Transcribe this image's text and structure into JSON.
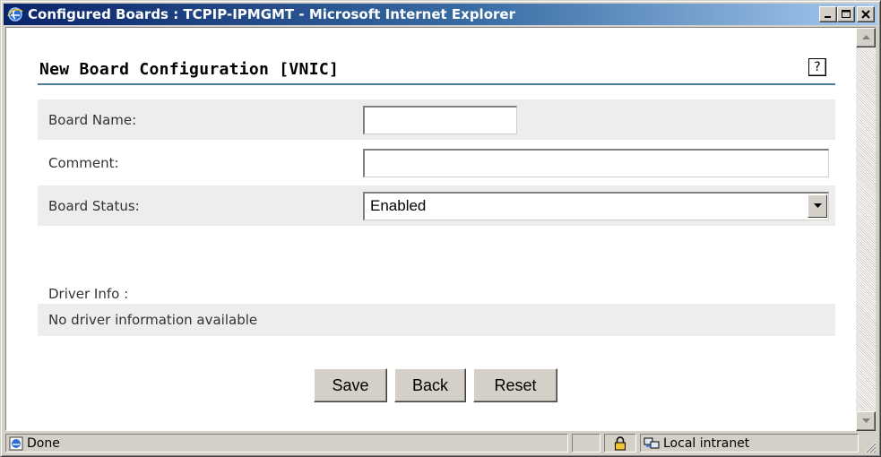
{
  "window": {
    "title": "Configured Boards : TCPIP-IPMGMT - Microsoft Internet Explorer",
    "minimize_label": "_",
    "maximize_label": "□",
    "close_label": "✕"
  },
  "page": {
    "title": "New Board Configuration [VNIC]",
    "help_label": "?"
  },
  "form": {
    "board_name": {
      "label": "Board Name:",
      "value": ""
    },
    "comment": {
      "label": "Comment:",
      "value": ""
    },
    "board_status": {
      "label": "Board Status:",
      "value": "Enabled"
    }
  },
  "driver": {
    "label": "Driver Info :",
    "text": "No driver information available"
  },
  "buttons": {
    "save": "Save",
    "back": "Back",
    "reset": "Reset"
  },
  "statusbar": {
    "status_text": "Done",
    "zone_text": "Local intranet"
  },
  "colors": {
    "titlebar_start": "#0a246a",
    "titlebar_end": "#a6caf0",
    "header_underline": "#4e7b9c",
    "row_shade": "#ededed",
    "chrome": "#d4d0c8"
  }
}
